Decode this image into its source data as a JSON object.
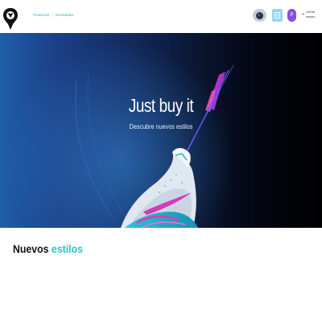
{
  "header": {
    "logo_icon": "cheetah-logo-icon",
    "nav": {
      "products_label": "Productos",
      "separator": "|",
      "new_label": "Novedades"
    },
    "theme_toggle_icon": "moon-icon",
    "cart_icon": "cart-icon",
    "user_initial": "P",
    "logout_icon": "logout-icon",
    "logout_label": "Cerrar sesión"
  },
  "hero": {
    "title": "Just buy it",
    "subtitle": "Descubre nuevos estilos"
  },
  "section": {
    "title_part1": "Nuevos",
    "title_part2": "estilos"
  },
  "colors": {
    "accent": "#22c7c0",
    "user_avatar": "#8a4fd8",
    "cart_button": "#9ad5ee"
  }
}
